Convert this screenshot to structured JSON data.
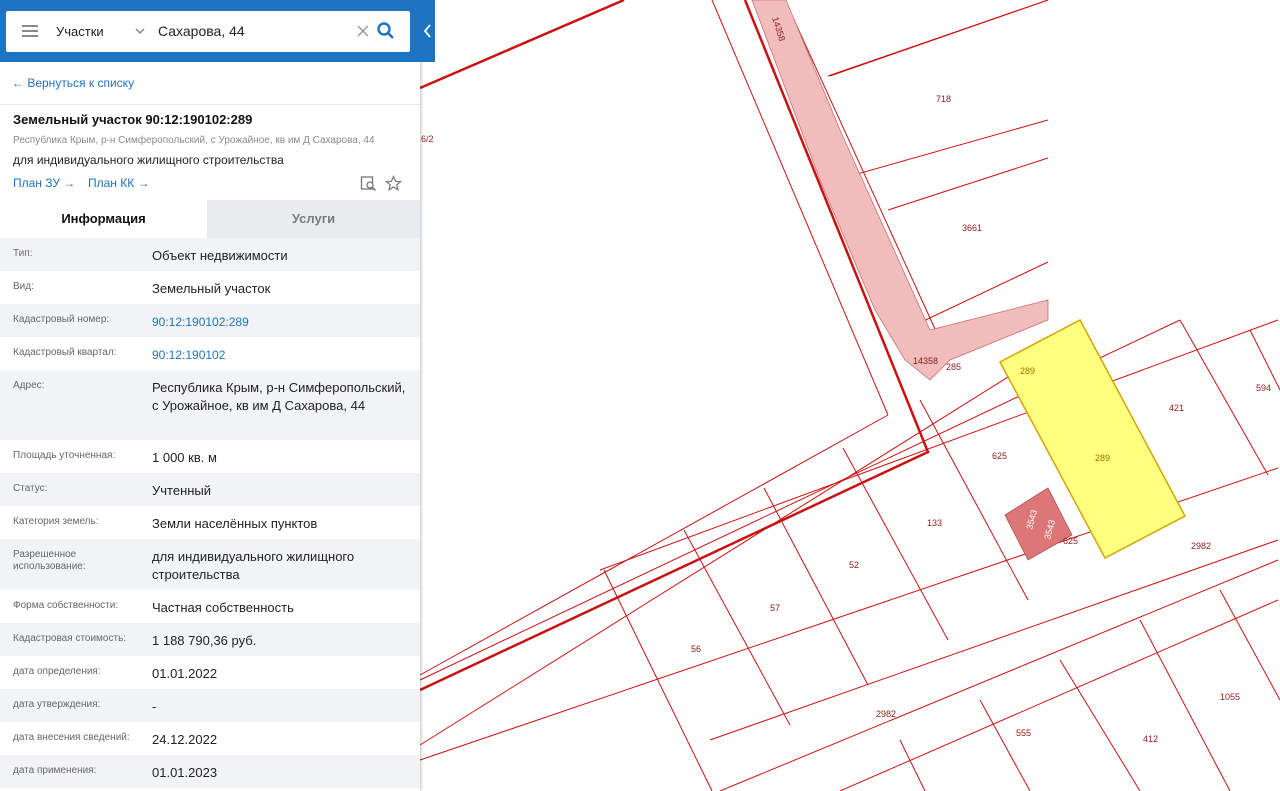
{
  "search": {
    "layer": "Участки",
    "query": "Сахарова, 44"
  },
  "nav": {
    "back_label": "← Вернуться к списку"
  },
  "object": {
    "title": "Земельный участок 90:12:190102:289",
    "address_short": "Республика Крым, р-н Симферопольский, с Урожайное, кв им Д Сахарова, 44",
    "purpose": "для индивидуального жилищного строительства",
    "plan_zu": "План ЗУ →",
    "plan_kk": "План КК →"
  },
  "tabs": [
    "Информация",
    "Услуги"
  ],
  "info_rows": [
    {
      "label": "Тип:",
      "value": "Объект недвижимости"
    },
    {
      "label": "Вид:",
      "value": "Земельный участок"
    },
    {
      "label": "Кадастровый номер:",
      "value": "90:12:190102:289"
    },
    {
      "label": "Кадастровый квартал:",
      "value": "90:12:190102"
    },
    {
      "label": "Адрес:",
      "value": "Республика Крым, р-н Симферопольский, с Урожайное, кв им Д Сахарова, 44"
    },
    {
      "label": "Площадь уточненная:",
      "value": "1 000 кв. м"
    },
    {
      "label": "Статус:",
      "value": "Учтенный"
    },
    {
      "label": "Категория земель:",
      "value": "Земли населённых пунктов"
    },
    {
      "label": "Разрешенное использование:",
      "value": "для индивидуального жилищного строительства"
    },
    {
      "label": "Форма собственности:",
      "value": "Частная собственность"
    },
    {
      "label": "Кадастровая стоимость:",
      "value": "1 188 790,36 руб."
    },
    {
      "label": "дата определения:",
      "value": "01.01.2022"
    },
    {
      "label": "дата утверждения:",
      "value": "-"
    },
    {
      "label": "дата внесения сведений:",
      "value": "24.12.2022"
    },
    {
      "label": "дата применения:",
      "value": "01.01.2023"
    }
  ],
  "map": {
    "labels": [
      "14358",
      "718",
      "3661",
      "14358",
      "285",
      "289",
      "289",
      "421",
      "594",
      "625",
      "625",
      "133",
      "3543",
      "3543",
      "52",
      "57",
      "56",
      "2982",
      "2982",
      "555",
      "412",
      "1055",
      "6/2"
    ]
  },
  "colors": {
    "accent": "#1c73c2",
    "parcel_border": "#cc0000",
    "selected_fill": "#ffff80",
    "road_fill": "#f0bcbc",
    "building_fill": "#dd7777"
  }
}
